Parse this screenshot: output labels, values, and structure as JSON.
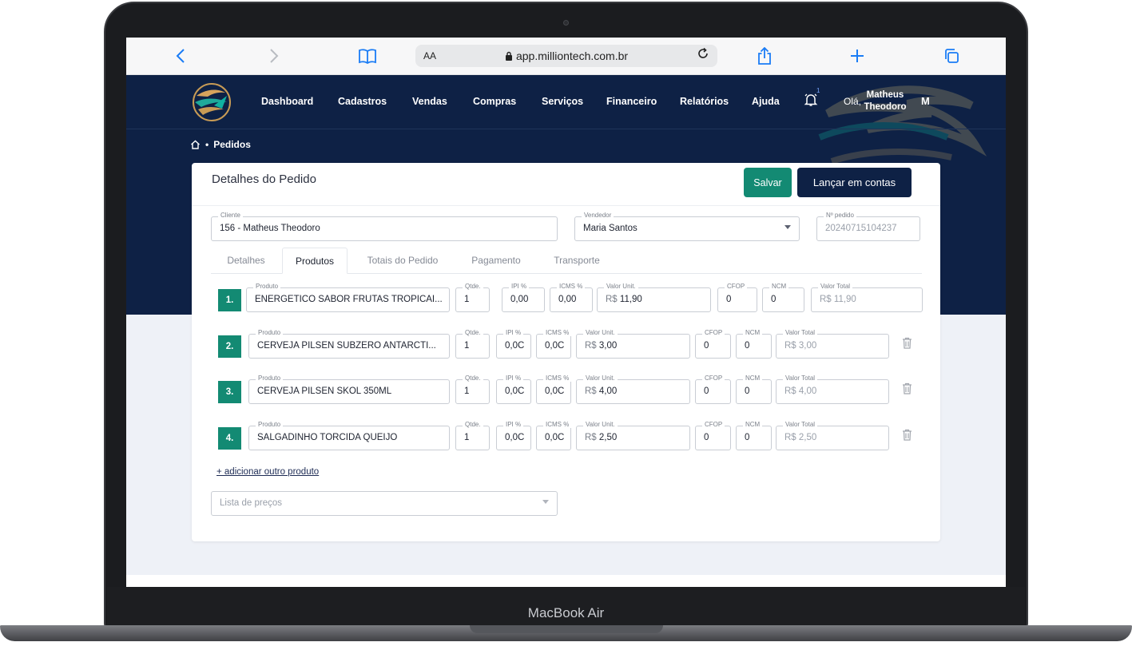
{
  "device": {
    "brand": "MacBook Air"
  },
  "browser": {
    "url": "app.milliontech.com.br",
    "text_size": "AA"
  },
  "nav": {
    "items": [
      "Dashboard",
      "Cadastros",
      "Vendas",
      "Compras",
      "Serviços",
      "Financeiro",
      "Relatórios",
      "Ajuda"
    ],
    "notification_count": "1",
    "greeting": "Olá,",
    "user_first": "Matheus",
    "user_last": "Theodoro",
    "avatar": "M"
  },
  "breadcrumb": {
    "current": "Pedidos"
  },
  "order": {
    "title": "Detalhes do Pedido",
    "save_label": "Salvar",
    "launch_label": "Lançar em contas",
    "client_label": "Cliente",
    "client_value": "156 - Matheus Theodoro",
    "seller_label": "Vendedor",
    "seller_value": "Maria Santos",
    "number_label": "Nº pedido",
    "number_value": "20240715104237",
    "tabs": [
      "Detalhes",
      "Produtos",
      "Totais do Pedido",
      "Pagamento",
      "Transporte"
    ],
    "active_tab": "Produtos",
    "labels": {
      "product": "Produto",
      "qty": "Qtde.",
      "ipi": "IPI %",
      "icms": "ICMS %",
      "unit": "Valor Unit.",
      "cfop": "CFOP",
      "ncm": "NCM",
      "total": "Valor Total"
    },
    "currency": "R$",
    "items": [
      {
        "num": "1.",
        "product": "ENERGÉTICO SABOR FRUTAS TROPICAI...",
        "qty": "1",
        "ipi": "0,00",
        "icms": "0,00",
        "unit": "11,90",
        "cfop": "0",
        "ncm": "0",
        "total": "11,90"
      },
      {
        "num": "2.",
        "product": "CERVEJA PILSEN SUBZERO ANTARCTI...",
        "qty": "1",
        "ipi": "0,0C",
        "icms": "0,0C",
        "unit": "3,00",
        "cfop": "0",
        "ncm": "0",
        "total": "3,00"
      },
      {
        "num": "3.",
        "product": "CERVEJA PILSEN SKOL 350ML",
        "qty": "1",
        "ipi": "0,0C",
        "icms": "0,0C",
        "unit": "4,00",
        "cfop": "0",
        "ncm": "0",
        "total": "4,00"
      },
      {
        "num": "4.",
        "product": "SALGADINHO TORCIDA QUEIJO",
        "qty": "1",
        "ipi": "0,0C",
        "icms": "0,0C",
        "unit": "2,50",
        "cfop": "0",
        "ncm": "0",
        "total": "2,50"
      }
    ],
    "add_product": "+ adicionar outro produto",
    "price_list_placeholder": "Lista de preços"
  },
  "colors": {
    "navy": "#0e2145",
    "teal": "#138a73",
    "accent_blue": "#1a7cf5"
  },
  "icons": [
    "back-icon",
    "forward-icon",
    "bookmarks-icon",
    "lock-icon",
    "reload-icon",
    "share-icon",
    "new-tab-icon",
    "tabs-icon",
    "bell-icon",
    "home-icon",
    "trash-icon"
  ]
}
